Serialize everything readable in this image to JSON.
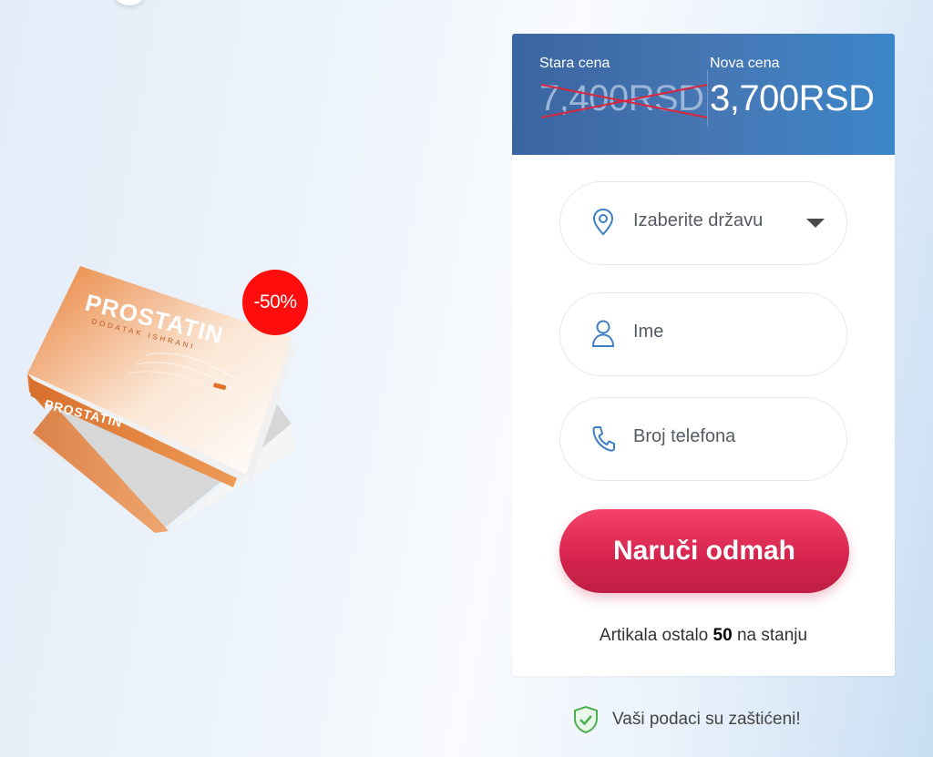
{
  "badge": {
    "discount": "-50%"
  },
  "product": {
    "brand_name": "PROSTATIN",
    "subtitle": "DODATAK ISHRANI"
  },
  "price": {
    "old_label": "Stara cena",
    "old_value": "7,400RSD",
    "new_label": "Nova cena",
    "new_value": "3,700RSD"
  },
  "form": {
    "country_placeholder": "Izaberite državu",
    "name_placeholder": "Ime",
    "phone_placeholder": "Broj telefona",
    "submit_label": "Naruči odmah"
  },
  "stock": {
    "prefix": "Artikala ostalo",
    "count": "50",
    "suffix": "na stanju"
  },
  "secure_note": "Vaši podaci su zaštićeni!",
  "colors": {
    "header_blue": "#3f6fac",
    "button_red": "#d92a52",
    "badge_red": "#ff0c0c",
    "icon_blue": "#3d7fc4",
    "shield_green": "#4caf50"
  },
  "icons": [
    "location-pin-icon",
    "user-icon",
    "phone-icon",
    "chevron-down-icon",
    "shield-check-icon"
  ]
}
